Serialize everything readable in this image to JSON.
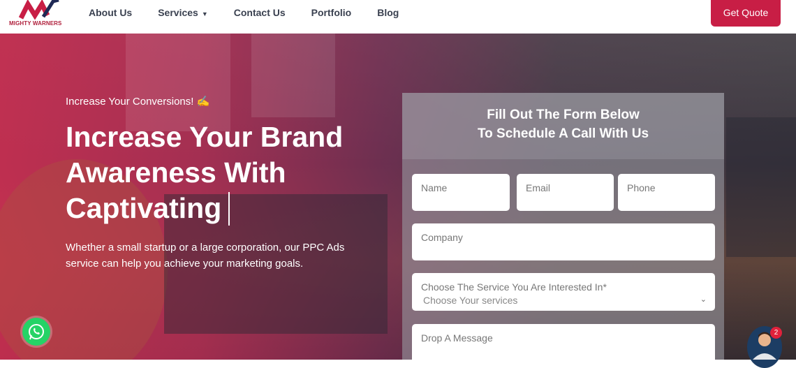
{
  "brand": {
    "name": "MIGHTY WARNERS",
    "color": "#c81e45"
  },
  "nav": {
    "items": [
      {
        "label": "About Us"
      },
      {
        "label": "Services",
        "has_dropdown": true
      },
      {
        "label": "Contact Us"
      },
      {
        "label": "Portfolio"
      },
      {
        "label": "Blog"
      }
    ],
    "cta_label": "Get Quote"
  },
  "hero": {
    "eyebrow": "Increase Your Conversions! ✍",
    "headline": "Increase Your Brand Awareness With Captivating",
    "subtext": "Whether a small startup or a large corporation, our PPC Ads service can help you achieve your marketing goals."
  },
  "form": {
    "title_line1": "Fill Out The Form Below",
    "title_line2": "To Schedule A Call With Us",
    "name_label": "Name",
    "email_label": "Email",
    "phone_label": "Phone",
    "company_label": "Company",
    "service_label": "Choose The Service You Are Interested In*",
    "service_value": "Choose Your services",
    "message_label": "Drop A Message"
  },
  "widgets": {
    "whatsapp_icon": "whatsapp-icon",
    "chat_badge_count": "2"
  }
}
